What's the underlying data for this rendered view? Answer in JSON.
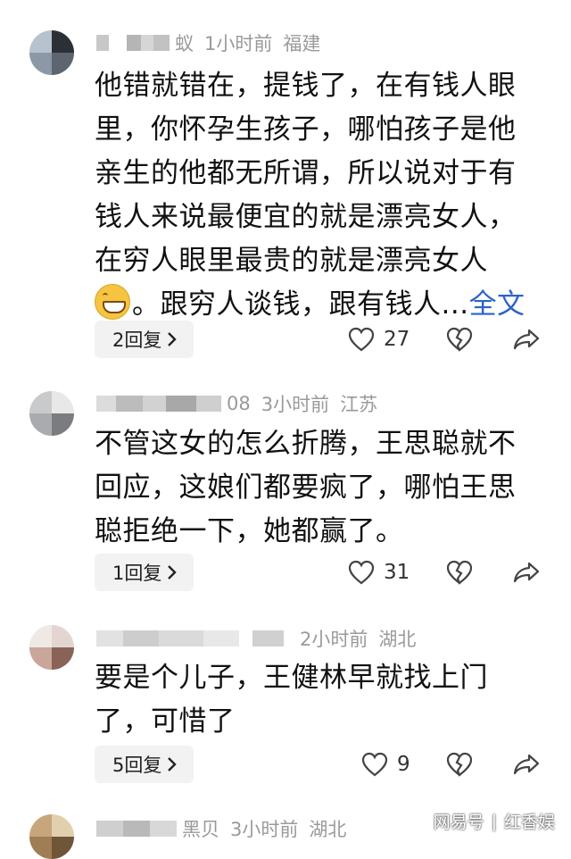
{
  "comments": [
    {
      "username_visible": "蚁",
      "time": "1小时前",
      "location": "福建",
      "lines": [
        "他错就错在，提钱了，在有钱人眼",
        "里，你怀孕生孩子，哪怕孩子是他",
        "亲生的他都无所谓，所以说对于有",
        "钱人来说最便宜的就是漂亮女人，",
        "在穷人眼里最贵的就是漂亮女人"
      ],
      "last_line": "。跟穷人谈钱，跟有钱人...",
      "more_label": "全文",
      "emoji_icon": "grinning-face-emoji",
      "reply_label": "2回复",
      "likes": "27"
    },
    {
      "username_visible": "08",
      "time": "3小时前",
      "location": "江苏",
      "lines": [
        "不管这女的怎么折腾，王思聪就不",
        "回应，这娘们都要疯了，哪怕王思",
        "聪拒绝一下，她都赢了。"
      ],
      "reply_label": "1回复",
      "likes": "31"
    },
    {
      "username_visible": "",
      "time": "2小时前",
      "location": "湖北",
      "lines": [
        "要是个儿子，王健林早就找上门",
        "了，可惜了"
      ],
      "reply_label": "5回复",
      "likes": "9"
    },
    {
      "username_visible": "黑贝",
      "time": "3小时前",
      "location": "湖北"
    }
  ],
  "watermark": {
    "text1": "网易号",
    "text2": "红香娱"
  },
  "icons": {
    "like": "heart-icon",
    "dislike": "broken-heart-icon",
    "share": "share-arrow-icon",
    "chevron": "chevron-right-icon"
  }
}
